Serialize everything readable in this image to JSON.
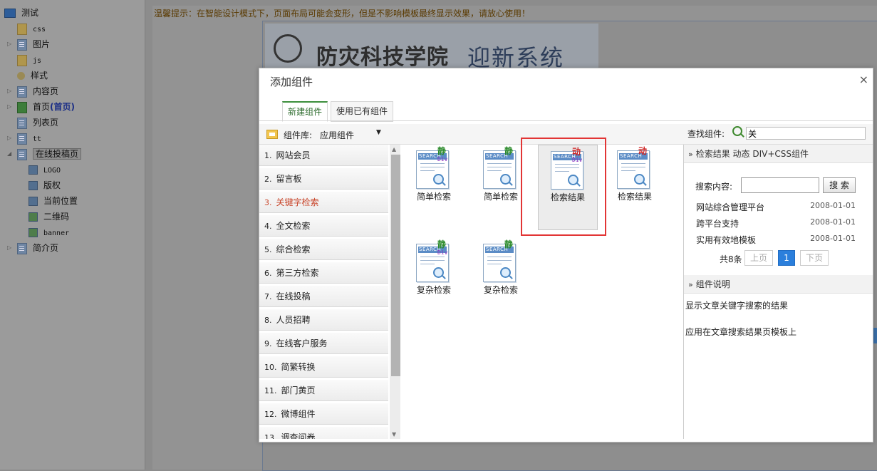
{
  "tree": {
    "items": [
      {
        "label": "测试",
        "icon": "monitor-icon"
      },
      {
        "label": "css",
        "icon": "folder-icon"
      },
      {
        "label": "图片",
        "icon": "page-icon"
      },
      {
        "label": "js",
        "icon": "folder-icon"
      },
      {
        "label": "样式",
        "icon": "gear-icon"
      },
      {
        "label": "内容页",
        "icon": "page-icon"
      },
      {
        "label": "首页",
        "suffix": "(首页)",
        "icon": "home-icon"
      },
      {
        "label": "列表页",
        "icon": "page-icon"
      },
      {
        "label": "tt",
        "icon": "page-icon"
      },
      {
        "label": "在线投稿页",
        "icon": "page-icon"
      },
      {
        "label": "LOGO",
        "icon": "component-icon"
      },
      {
        "label": "版权",
        "icon": "component-icon"
      },
      {
        "label": "当前位置",
        "icon": "component-icon"
      },
      {
        "label": "二维码",
        "icon": "component-icon"
      },
      {
        "label": "banner",
        "icon": "component-icon"
      },
      {
        "label": "简介页",
        "icon": "page-icon"
      }
    ]
  },
  "notice": "温馨提示：在智能设计模式下，页面布局可能会变形，但是不影响模板最终显示效果，请放心使用！",
  "banner": {
    "school": "防灾科技学院",
    "system": "迎新系统"
  },
  "dialog": {
    "title": "添加组件",
    "close": "×",
    "tabs": [
      "新建组件",
      "使用已有组件"
    ],
    "library_label": "组件库:",
    "library_value": "应用组件",
    "find_label": "查找组件:",
    "find_value": "关",
    "categories": [
      {
        "num": "1.",
        "label": "网站会员"
      },
      {
        "num": "2.",
        "label": "留言板"
      },
      {
        "num": "3.",
        "label": "关键字检索"
      },
      {
        "num": "4.",
        "label": "全文检索"
      },
      {
        "num": "5.",
        "label": "综合检索"
      },
      {
        "num": "6.",
        "label": "第三方检索"
      },
      {
        "num": "7.",
        "label": "在线投稿"
      },
      {
        "num": "8.",
        "label": "人员招聘"
      },
      {
        "num": "9.",
        "label": "在线客户服务"
      },
      {
        "num": "10.",
        "label": "简繁转换"
      },
      {
        "num": "11.",
        "label": "部门黄页"
      },
      {
        "num": "12.",
        "label": "微博组件"
      },
      {
        "num": "13.",
        "label": "调查问卷"
      }
    ],
    "active_category": 3,
    "components": [
      {
        "label": "简单检索",
        "badge": "静",
        "div": "Div",
        "header": "SEARCH"
      },
      {
        "label": "简单检索",
        "badge": "静",
        "div": "",
        "header": "SEARCH"
      },
      {
        "label": "检索结果",
        "badge": "动",
        "div": "Div",
        "header": "SEARCH"
      },
      {
        "label": "检索结果",
        "badge": "动",
        "div": "",
        "header": "SEARCH"
      },
      {
        "label": "复杂检索",
        "badge": "静",
        "div": "Div",
        "header": "SEARCH"
      },
      {
        "label": "复杂检索",
        "badge": "静",
        "div": "",
        "header": "SEARCH"
      }
    ],
    "selected_component": 3,
    "preview": {
      "header": "检索结果 动态 DIV+CSS组件",
      "search_label": "搜索内容:",
      "search_button": "搜 索",
      "rows": [
        {
          "title": "网站综合管理平台",
          "date": "2008-01-01"
        },
        {
          "title": "跨平台支持",
          "date": "2008-01-01"
        },
        {
          "title": "实用有效地模板",
          "date": "2008-01-01"
        }
      ],
      "pager": {
        "total": "共8条",
        "prev": "上页",
        "current": "1",
        "next": "下页"
      },
      "desc_header": "组件说明",
      "desc_lines": [
        "显示文章关键字搜索的结果",
        "应用在文章搜索结果页模板上"
      ]
    },
    "colors": {
      "accent_green": "#3c8f3c",
      "highlight_red": "#e23535",
      "pager_blue": "#2b7fdc"
    }
  }
}
